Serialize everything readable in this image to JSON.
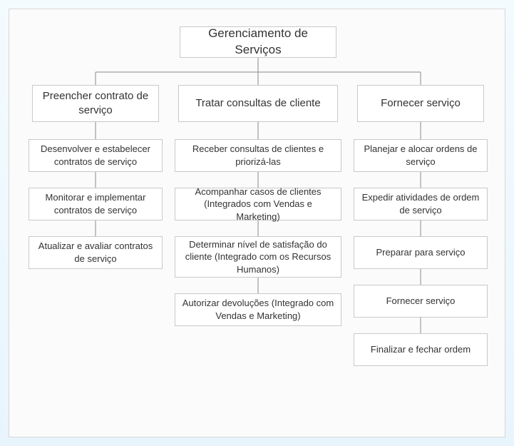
{
  "root": {
    "title": "Gerenciamento de Serviços"
  },
  "branches": [
    {
      "title": "Preencher contrato de serviço"
    },
    {
      "title": "Tratar consultas de cliente"
    },
    {
      "title": "Fornecer serviço"
    }
  ],
  "col1": [
    {
      "text": "Desenvolver e estabelecer contratos de serviço"
    },
    {
      "text": "Monitorar e implementar contratos de serviço"
    },
    {
      "text": "Atualizar e avaliar contratos de serviço"
    }
  ],
  "col2": [
    {
      "text": "Receber consultas de clientes e priorizá-las"
    },
    {
      "text": "Acompanhar casos de clientes (Integrados com Vendas e Marketing)"
    },
    {
      "text": "Determinar nível de satisfação do cliente (Integrado com os Recursos Humanos)"
    },
    {
      "text": "Autorizar devoluções (Integrado com Vendas e Marketing)"
    }
  ],
  "col3": [
    {
      "text": "Planejar e alocar ordens de serviço"
    },
    {
      "text": "Expedir atividades de ordem de serviço"
    },
    {
      "text": "Preparar para serviço"
    },
    {
      "text": "Fornecer serviço"
    },
    {
      "text": "Finalizar e fechar ordem"
    }
  ]
}
